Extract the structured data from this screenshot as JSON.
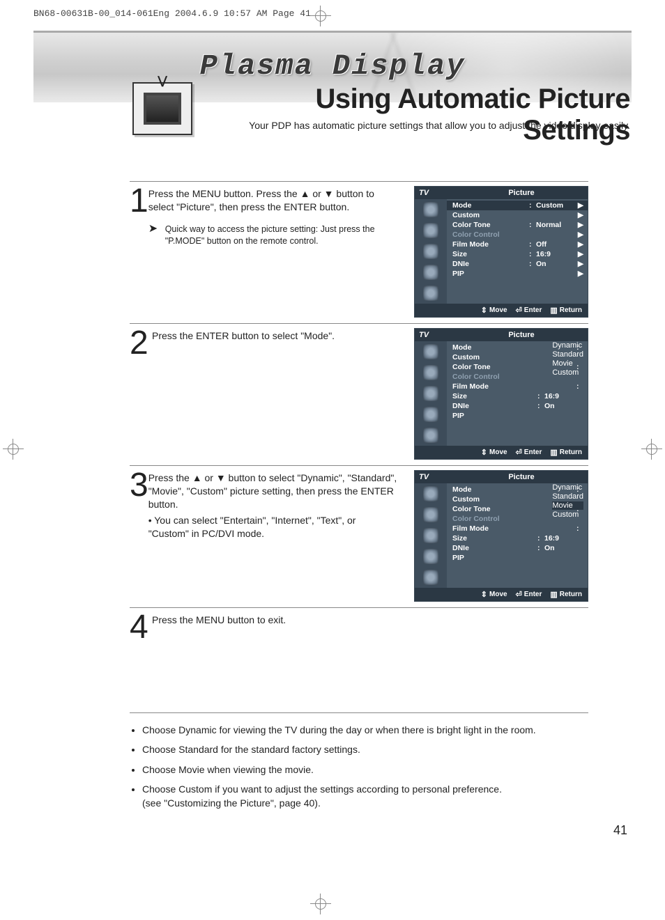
{
  "print_header": "BN68-00631B-00_014-061Eng  2004.6.9  10:57 AM  Page 41",
  "plasma_title": "Plasma Display",
  "page_title": "Using Automatic Picture Settings",
  "page_subtitle": "Your PDP has automatic picture settings that allow you to adjust the video display easily.",
  "page_number": "41",
  "steps": {
    "s1": {
      "num": "1",
      "text": "Press the MENU button. Press the ▲ or ▼ button to select \"Picture\", then press the ENTER button.",
      "sub": "Quick way to access the picture setting: Just press the \"P.MODE\" button on the remote control."
    },
    "s2": {
      "num": "2",
      "text": "Press the ENTER button to select \"Mode\"."
    },
    "s3": {
      "num": "3",
      "text": "Press the ▲ or ▼ button to select \"Dynamic\", \"Standard\", \"Movie\", \"Custom\" picture setting, then press the ENTER button.",
      "bullet": "• You can select \"Entertain\", \"Internet\", \"Text\", or \"Custom\" in PC/DVI mode."
    },
    "s4": {
      "num": "4",
      "text": "Press the MENU button to exit."
    }
  },
  "notes": {
    "n1": "Choose Dynamic for viewing the TV during the day or when there is bright light in the room.",
    "n2": "Choose Standard for the standard factory settings.",
    "n3": "Choose Movie when viewing the movie.",
    "n4a": "Choose Custom if you want to adjust the settings according to personal preference.",
    "n4b": "(see \"Customizing the Picture\", page 40)."
  },
  "osd": {
    "tv": "TV",
    "title": "Picture",
    "rows": {
      "mode": "Mode",
      "custom": "Custom",
      "color_tone": "Color Tone",
      "color_control": "Color Control",
      "film_mode": "Film Mode",
      "size": "Size",
      "dnle": "DNIe",
      "pip": "PIP"
    },
    "vals": {
      "mode": "Custom",
      "color_tone": "Normal",
      "film_mode": "Off",
      "size": "16:9",
      "dnle": "On"
    },
    "options": {
      "o1": "Dynamic",
      "o2": "Standard",
      "o3": "Movie",
      "o4": "Custom"
    },
    "footer": {
      "move": "Move",
      "enter": "Enter",
      "return": "Return"
    }
  }
}
